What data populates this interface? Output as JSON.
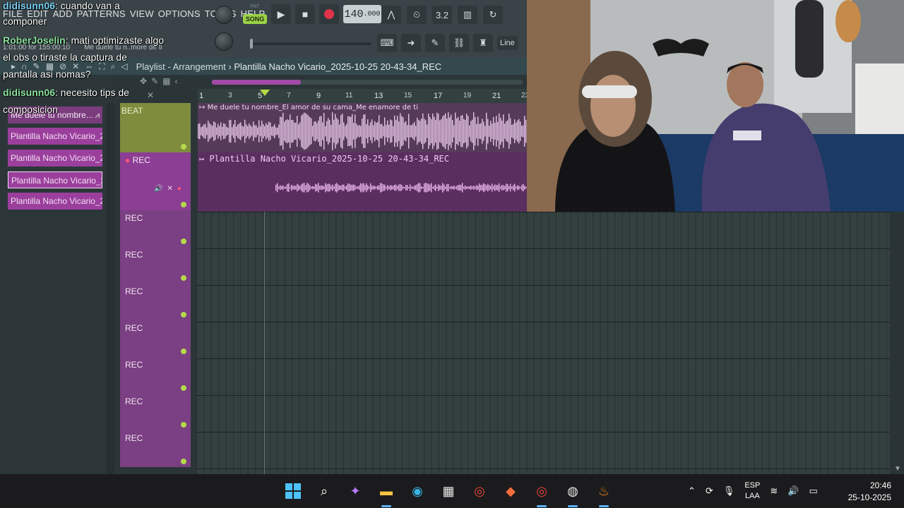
{
  "menu": [
    "FILE",
    "EDIT",
    "ADD",
    "PATTERNS",
    "VIEW",
    "OPTIONS",
    "TOOLS",
    "HELP"
  ],
  "transport": {
    "pat_label": "PAT",
    "song_label": "SONG",
    "tempo_main": "140",
    "tempo_frac": ".000"
  },
  "hint": {
    "position": "1:01:00 for 155:00:10",
    "clip": "Me duele tu n..more de ti"
  },
  "toolbar": {
    "line_label": "Line"
  },
  "playlist": {
    "view": "Playlist - Arrangement",
    "project": "Plantilla Nacho Vicario_2025-10-25 20-43-34_REC"
  },
  "picker": {
    "items": [
      "Me duele tu nombre...",
      "Plantilla Nacho Vicario_2...",
      "Plantilla Nacho Vicario_2...",
      "Plantilla Nacho Vicario_2...",
      "Plantilla Nacho Vicario_2..."
    ]
  },
  "ruler": [
    "1",
    "3",
    "5",
    "7",
    "9",
    "11",
    "13",
    "15",
    "17",
    "19",
    "21",
    "23"
  ],
  "tracks": {
    "beat_name": "BEAT",
    "rec_name": "REC",
    "empty_tracks": [
      "REC",
      "REC",
      "REC",
      "REC",
      "REC",
      "REC",
      "REC"
    ]
  },
  "clips": {
    "beat": "Me duele tu nombre_El amor de su cama_Me enamore de ti",
    "rec": "Plantilla Nacho Vicario_2025-10-25 20-43-34_REC"
  },
  "chat": [
    {
      "user": "didisunn06",
      "text": ": cuando van a"
    },
    {
      "user": "",
      "text": "componer"
    },
    {
      "user": "RoberJoselin",
      "text": ": mati optimizaste algo"
    },
    {
      "user": "",
      "text": "el obs o tiraste la captura de"
    },
    {
      "user": "",
      "text": "pantalla asi nomas?"
    },
    {
      "user": "didisunn06",
      "text": ": necesito tips de"
    },
    {
      "user": "",
      "text": "composicion"
    }
  ],
  "taskbar": {
    "lang_top": "ESP",
    "lang_bottom": "LAA",
    "time": "20:46",
    "date": "25-10-2025"
  },
  "colors": {
    "song_accent": "#9bd146",
    "clip_purple": "#9b3f9d",
    "beat_track": "#7f8c3e",
    "record": "#e0334b"
  }
}
